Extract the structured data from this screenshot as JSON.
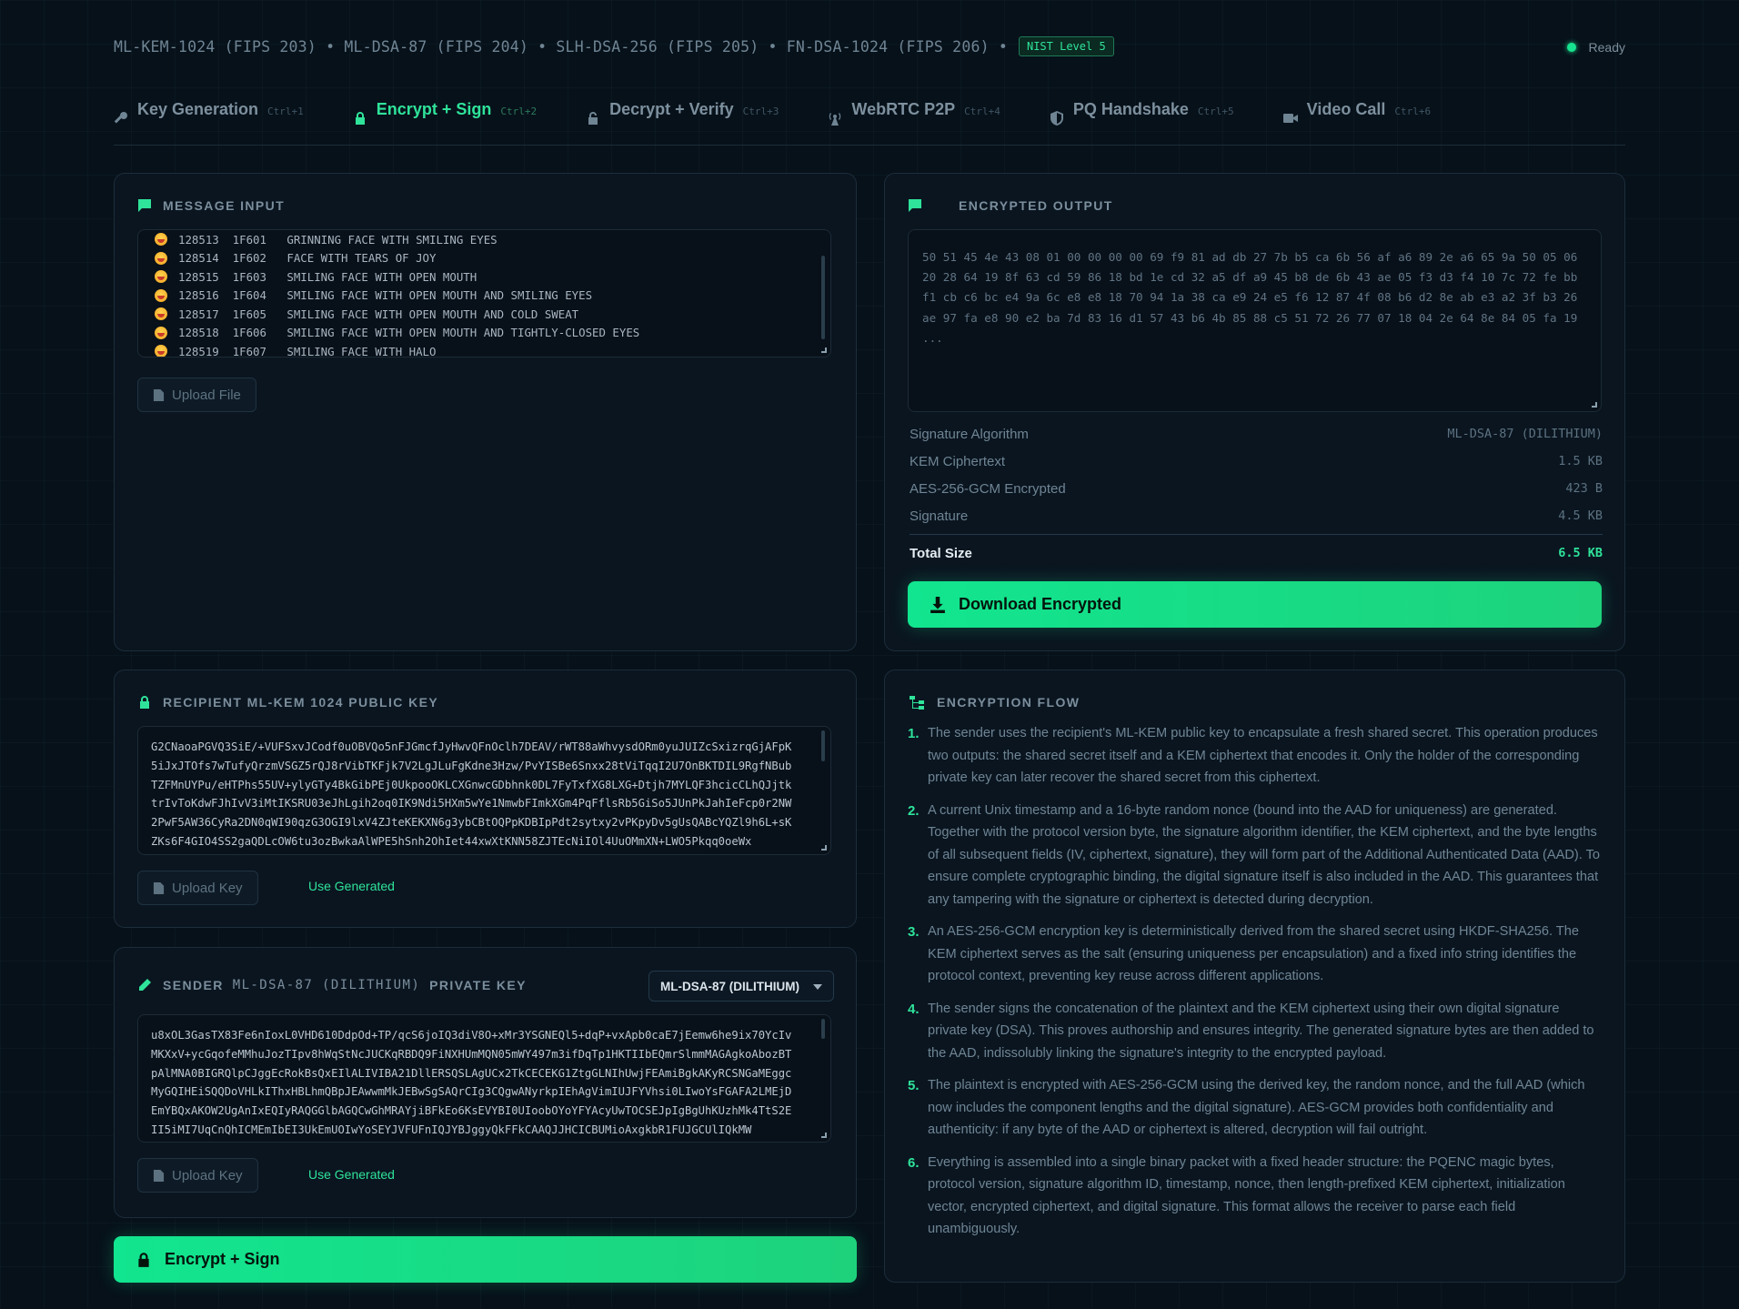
{
  "header": {
    "algorithms": "ML-KEM-1024 (FIPS 203) • ML-DSA-87 (FIPS 204) • SLH-DSA-256 (FIPS 205) • FN-DSA-1024 (FIPS 206) •",
    "nist_badge": "NIST Level 5",
    "status": "Ready",
    "status_color": "#17e38f"
  },
  "tabs": [
    {
      "icon": "key-icon",
      "label": "Key Generation",
      "shortcut": "Ctrl+1"
    },
    {
      "icon": "lock-icon",
      "label": "Encrypt + Sign",
      "shortcut": "Ctrl+2",
      "active": true
    },
    {
      "icon": "unlock-icon",
      "label": "Decrypt + Verify",
      "shortcut": "Ctrl+3"
    },
    {
      "icon": "antenna-icon",
      "label": "WebRTC P2P",
      "shortcut": "Ctrl+4"
    },
    {
      "icon": "shield-icon",
      "label": "PQ Handshake",
      "shortcut": "Ctrl+5"
    },
    {
      "icon": "video-icon",
      "label": "Video Call",
      "shortcut": "Ctrl+6"
    }
  ],
  "message_input": {
    "title": "MESSAGE INPUT",
    "rows": [
      "128513  1F601   GRINNING FACE WITH SMILING EYES",
      "128514  1F602   FACE WITH TEARS OF JOY",
      "128515  1F603   SMILING FACE WITH OPEN MOUTH",
      "128516  1F604   SMILING FACE WITH OPEN MOUTH AND SMILING EYES",
      "128517  1F605   SMILING FACE WITH OPEN MOUTH AND COLD SWEAT",
      "128518  1F606   SMILING FACE WITH OPEN MOUTH AND TIGHTLY-CLOSED EYES",
      "128519  1F607   SMILING FACE WITH HALO"
    ],
    "upload_label": "Upload File"
  },
  "recipient": {
    "title": "RECIPIENT ML-KEM 1024 PUBLIC KEY",
    "key_text": "G2CNaoaPGVQ3SiE/+VUFSxvJCodf0uOBVQo5nFJGmcfJyHwvQFnOclh7DEAV/rWT88aWhvysdORm0yuJUIZcSxizrqGjAFpK5iJxJTOfs7wTufyQrzmVSGZ5rQJ8rVibTKFjk7V2LgJLuFgKdne3Hzw/PvYISBe6Snxx28tViTqqI2U7OnBKTDIL9RgfNBubTZFMnUYPu/eHTPhs55UV+ylyGTy4BkGibPEj0UkpooOKLCXGnwcGDbhnk0DL7FyTxfXG8LXG+Dtjh7MYLQF3hcicCLhQJjtktrIvToKdwFJhIvV3iMtIKSRU03eJhLgih2oq0IK9Ndi5HXm5wYe1NmwbFImkXGm4PqFflsRb5GiSo5JUnPkJahIeFcp0r2NW2PwF5AW36CyRa2DN0qWI90qzG3OGI9lxV4ZJteKEKXN6g3ybCBtOQPpKDBIpPdt2sytxy2vPKpyDv5gUsQABcYQZl9h6L+sKZKs6F4GIO4SS2gaQDLcOW6tu3ozBwkaAlWPE5hSnh2OhIet44xwXtKNN58ZJTEcNiIOl4UuOMmXN+LWO5Pkqq0oeWx",
    "upload_label": "Upload Key",
    "use_generated": "Use Generated"
  },
  "sender": {
    "title_prefix": "SENDER",
    "algorithm": "ML-DSA-87 (DILITHIUM)",
    "title_suffix": "PRIVATE KEY",
    "select_value": "ML-DSA-87 (DILITHIUM)",
    "key_text": "u8xOL3GasTX83Fe6nIoxL0VHD610DdpOd+TP/qcS6joIQ3diV8O+xMr3YSGNEQl5+dqP+vxApb0caE7jEemw6he9ix70YcIvMKXxV+ycGqofeMMhuJozTIpv8hWqStNcJUCKqRBDQ9FiNXHUmMQN05mWY497m3ifDqTp1HKTIIbEQmrSlmmMAGAgkoAbozBTpAlMNA0BIGRQlpCJggEcRokBsQxEIlALIVIBA21DllERSQSLAgUCx2TkCECEKG1ZtgGLNIhUwjFEAmiBgkAKyRCSNGaMEggcMyGQIHEiSQQDoVHLkIThxHBLhmQBpJEAwwmMkJEBwSgSAQrCIg3CQgwANyrkpIEhAgVimIUJFYVhsi0LIwoYsFGAFA2LMEjDEmYBQxAKOW2UgAnIxEQIyRAQGGlbAGQCwGhMRAYjiBFkEo6KsEVYBI0UIoobOYoYFYAcyUwTOCSEJpIgBgUhKUzhMk4TtS2EII5iMI7UqCnQhICMEmIbEI3UkEmUOIwYoSEYJVFUFnIQJYBJggyQkFFkCAAQJJHCICBUMioAxgkbR1FUJGCUlIQkMW",
    "upload_label": "Upload Key",
    "use_generated": "Use Generated"
  },
  "encrypt_button": "Encrypt + Sign",
  "output": {
    "title": "ENCRYPTED OUTPUT",
    "hex_lines": [
      "50 51 45 4e 43 08 01 00 00 00 00 69 f9 81 ad db 27 7b b5 ca 6b 56 af a6 89 2e a6 65 9a 50 05 06",
      "20 28 64 19 8f 63 cd 59 86 18 bd 1e cd 32 a5 df a9 45 b8 de 6b 43 ae 05 f3 d3 f4 10 7c 72 fe bb",
      "f1 cb c6 bc e4 9a 6c e8 e8 18 70 94 1a 38 ca e9 24 e5 f6 12 87 4f 08 b6 d2 8e ab e3 a2 3f b3 26",
      "ae 97 fa e8 90 e2 ba 7d 83 16 d1 57 43 b6 4b 85 88 c5 51 72 26 77 07 18 04 2e 64 8e 84 05 fa 19",
      "..."
    ],
    "meta": [
      {
        "label": "Signature Algorithm",
        "value": "ML-DSA-87 (DILITHIUM)"
      },
      {
        "label": "KEM Ciphertext",
        "value": "1.5 KB"
      },
      {
        "label": "AES-256-GCM Encrypted",
        "value": "423 B"
      },
      {
        "label": "Signature",
        "value": "4.5 KB"
      }
    ],
    "total_label": "Total Size",
    "total_value": "6.5 KB",
    "download_label": "Download Encrypted"
  },
  "flow": {
    "title": "ENCRYPTION FLOW",
    "steps": [
      {
        "n": "1.",
        "text": "The sender uses the recipient's ML-KEM public key to encapsulate a fresh shared secret. This operation produces two outputs: the shared secret itself and a KEM ciphertext that encodes it. Only the holder of the corresponding private key can later recover the shared secret from this ciphertext."
      },
      {
        "n": "2.",
        "text": "A current Unix timestamp and a 16-byte random nonce (bound into the AAD for uniqueness) are generated. Together with the protocol version byte, the signature algorithm identifier, the KEM ciphertext, and the byte lengths of all subsequent fields (IV, ciphertext, signature), they will form part of the Additional Authenticated Data (AAD). To ensure complete cryptographic binding, the digital signature itself is also included in the AAD. This guarantees that any tampering with the signature or ciphertext is detected during decryption."
      },
      {
        "n": "3.",
        "text": "An AES-256-GCM encryption key is deterministically derived from the shared secret using HKDF-SHA256. The KEM ciphertext serves as the salt (ensuring uniqueness per encapsulation) and a fixed info string identifies the protocol context, preventing key reuse across different applications."
      },
      {
        "n": "4.",
        "text": "The sender signs the concatenation of the plaintext and the KEM ciphertext using their own digital signature private key (DSA). This proves authorship and ensures integrity. The generated signature bytes are then added to the AAD, indissolubly linking the signature's integrity to the encrypted payload."
      },
      {
        "n": "5.",
        "text": "The plaintext is encrypted with AES-256-GCM using the derived key, the random nonce, and the full AAD (which now includes the component lengths and the digital signature). AES-GCM provides both confidentiality and authenticity: if any byte of the AAD or ciphertext is altered, decryption will fail outright."
      },
      {
        "n": "6.",
        "text": "Everything is assembled into a single binary packet with a fixed header structure: the PQENC magic bytes, protocol version, signature algorithm ID, timestamp, nonce, then length-prefixed KEM ciphertext, initialization vector, encrypted ciphertext, and digital signature. This format allows the receiver to parse each field unambiguously."
      }
    ]
  },
  "colors": {
    "accent": "#2fe39a",
    "background": "#07111a",
    "panel": "#0b1621"
  }
}
